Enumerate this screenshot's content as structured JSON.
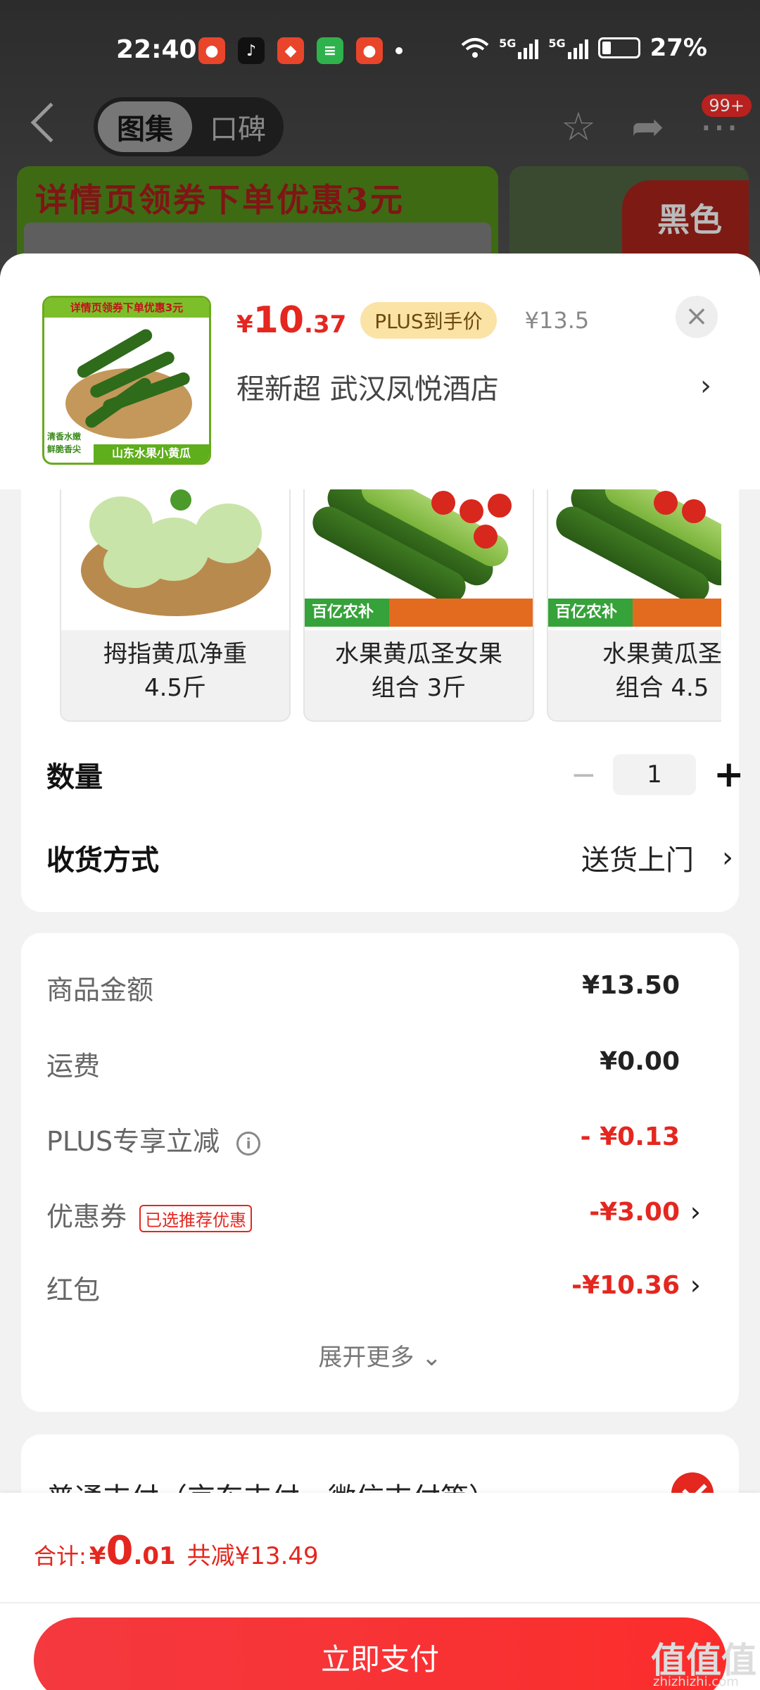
{
  "status_bar": {
    "time": "22:40",
    "battery": "27%",
    "net1": "5G",
    "net2": "5G"
  },
  "bg_nav": {
    "tab_active": "图集",
    "tab_inactive": "口碑",
    "badge": "99+",
    "banner_text": "详情页领券下单优惠3元",
    "side_banner_text": "黑色"
  },
  "product": {
    "thumb_top_text": "详情页领券下单优惠3元",
    "thumb_side_text_1": "清香水嫩",
    "thumb_side_text_2": "鲜脆香尖",
    "thumb_bottom_text": "山东水果小黄瓜",
    "price_yen": "¥",
    "price_int": "10",
    "price_dec": ".37",
    "plus_tag": "PLUS到手价",
    "orig_price": "¥13.5",
    "shop": "程新超  武汉凤悦酒店",
    "close_symbol": "×",
    "arrow": "›"
  },
  "specs": [
    {
      "line1": "拇指黄瓜净重",
      "line2": "4.5斤"
    },
    {
      "line1": "水果黄瓜圣女果",
      "line2": "组合 3斤",
      "logo": "百亿农补"
    },
    {
      "line1": "水果黄瓜圣",
      "line2": "组合 4.5",
      "logo": "百亿农补"
    }
  ],
  "quantity": {
    "label": "数量",
    "minus": "−",
    "value": "1",
    "plus": "+"
  },
  "delivery": {
    "label": "收货方式",
    "value": "送货上门",
    "arrow": "›"
  },
  "amounts": [
    {
      "label": "商品金额",
      "value": "¥13.50"
    },
    {
      "label": "运费",
      "value": "¥0.00"
    },
    {
      "label": "PLUS专享立减",
      "value": "- ¥0.13",
      "info": "i"
    },
    {
      "label": "优惠券",
      "tag": "已选推荐优惠",
      "value": "-¥3.00",
      "arrow": "›"
    },
    {
      "label": "红包",
      "value": "-¥10.36",
      "arrow": "›"
    }
  ],
  "expand_more": "展开更多 ⌄",
  "payment": {
    "label": "普通支付（京东支付、微信支付等）"
  },
  "footer": {
    "total_label": "合计:",
    "total_yen": "¥",
    "total_int": "0",
    "total_dec": ".01",
    "total_save": "共减¥13.49",
    "pay_button": "立即支付"
  },
  "watermark": {
    "main": "值值值",
    "sub": "zhizhizhi.com"
  },
  "colors": {
    "accent_red": "#e4271f",
    "plus_gold": "#fbe3a6"
  }
}
